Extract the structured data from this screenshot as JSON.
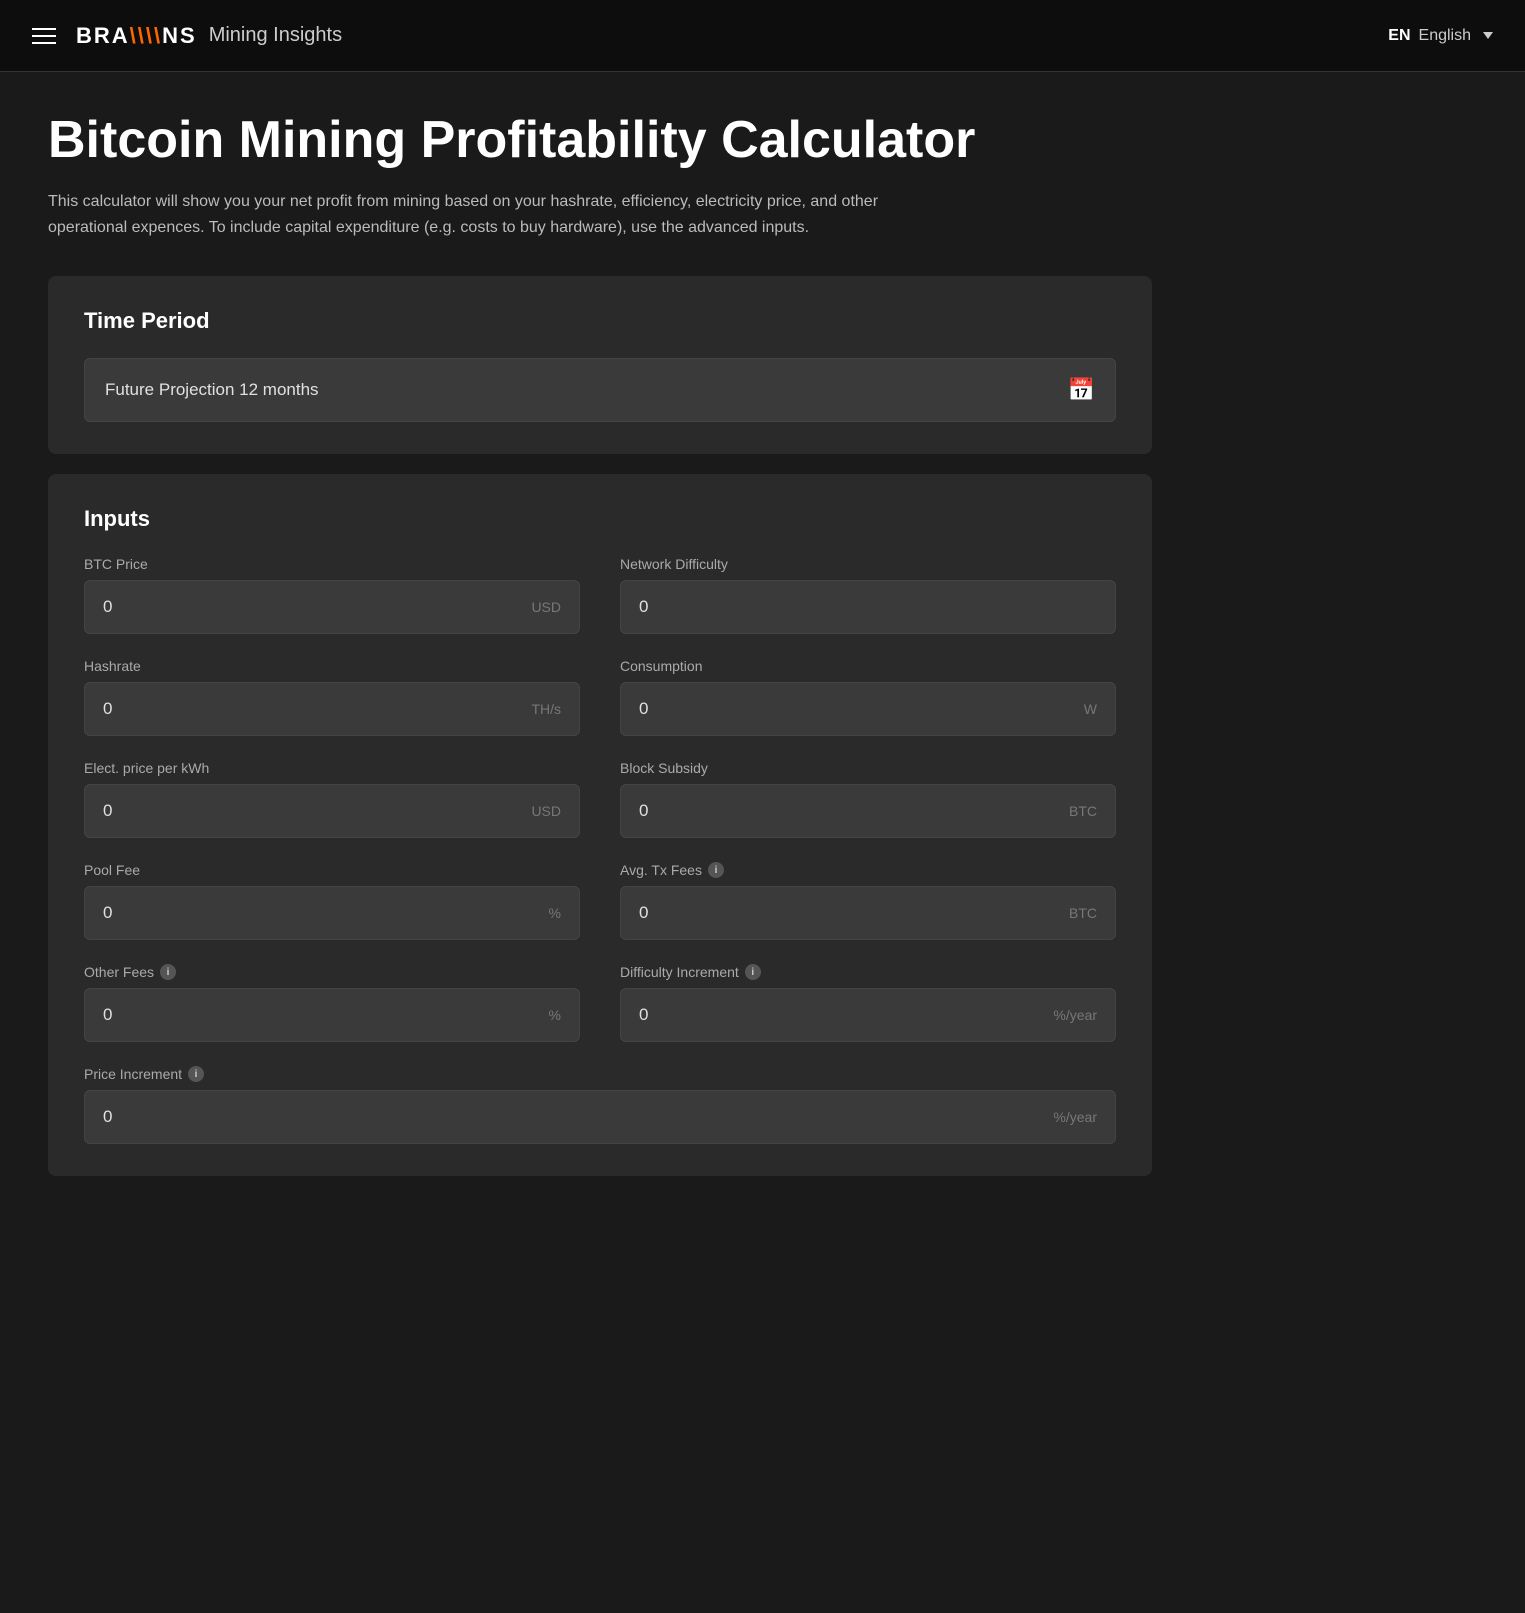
{
  "header": {
    "menu_label": "Menu",
    "logo_brand": "BRA\\NS",
    "logo_product": "Mining Insights",
    "lang_code": "EN",
    "lang_label": "English"
  },
  "page": {
    "title": "Bitcoin Mining Profitability Calculator",
    "description": "This calculator will show you your net profit from mining based on your hashrate, efficiency, electricity price, and other operational expences. To include capital expenditure (e.g. costs to buy hardware), use the advanced inputs."
  },
  "time_period": {
    "section_title": "Time Period",
    "selected_label": "Future Projection 12 months"
  },
  "inputs": {
    "section_title": "Inputs",
    "fields": [
      {
        "label": "BTC Price",
        "value": "0",
        "unit": "USD",
        "has_info": false,
        "id": "btc-price"
      },
      {
        "label": "Network Difficulty",
        "value": "0",
        "unit": "",
        "has_info": false,
        "id": "network-difficulty"
      },
      {
        "label": "Hashrate",
        "value": "0",
        "unit": "TH/s",
        "has_info": false,
        "id": "hashrate"
      },
      {
        "label": "Consumption",
        "value": "0",
        "unit": "W",
        "has_info": false,
        "id": "consumption"
      },
      {
        "label": "Elect. price per kWh",
        "value": "0",
        "unit": "USD",
        "has_info": false,
        "id": "elect-price"
      },
      {
        "label": "Block Subsidy",
        "value": "0",
        "unit": "BTC",
        "has_info": false,
        "id": "block-subsidy"
      },
      {
        "label": "Pool Fee",
        "value": "0",
        "unit": "%",
        "has_info": false,
        "id": "pool-fee"
      },
      {
        "label": "Avg. Tx Fees",
        "value": "0",
        "unit": "BTC",
        "has_info": true,
        "id": "avg-tx-fees"
      },
      {
        "label": "Other Fees",
        "value": "0",
        "unit": "%",
        "has_info": true,
        "id": "other-fees"
      },
      {
        "label": "Difficulty Increment",
        "value": "0",
        "unit": "%/year",
        "has_info": true,
        "id": "difficulty-increment"
      },
      {
        "label": "Price Increment",
        "value": "0",
        "unit": "%/year",
        "has_info": true,
        "id": "price-increment",
        "full_width": true
      }
    ]
  }
}
